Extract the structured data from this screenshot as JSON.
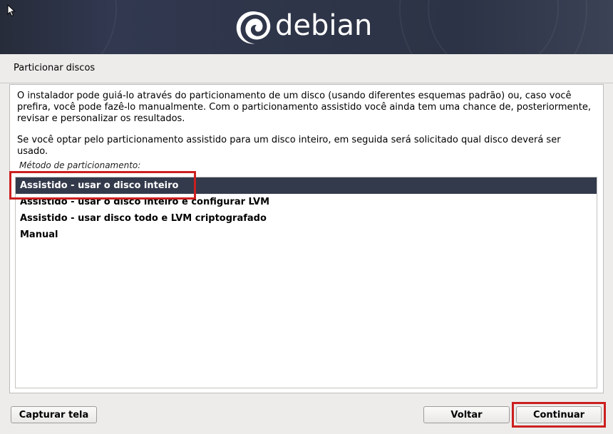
{
  "header": {
    "logo_text": "debian",
    "logo_icon": "debian-swirl-icon",
    "cursor_icon": "mouse-pointer-icon"
  },
  "page": {
    "title": "Particionar discos"
  },
  "content": {
    "paragraph1": "O instalador pode guiá-lo através do particionamento de um disco (usando diferentes esquemas padrão) ou, caso você prefira, você pode fazê-lo manualmente. Com o particionamento assistido você ainda tem uma chance de, posteriormente, revisar e personalizar os resultados.",
    "paragraph2": "Se você optar pelo particionamento assistido para um disco inteiro, em seguida será solicitado qual disco deverá ser usado.",
    "list_caption": "Método de particionamento:",
    "options": [
      "Assistido - usar o disco inteiro",
      "Assistido - usar o disco inteiro e configurar LVM",
      "Assistido - usar disco todo e LVM criptografado",
      "Manual"
    ],
    "selected_option": "Assistido - usar o disco inteiro"
  },
  "buttons": {
    "screenshot": "Capturar tela",
    "back": "Voltar",
    "continue": "Continuar"
  },
  "colors": {
    "header_bg": "#2e3548",
    "selection_bg": "#333a4b",
    "annotation_red": "#cc1f1f",
    "window_bg": "#edeceb"
  }
}
